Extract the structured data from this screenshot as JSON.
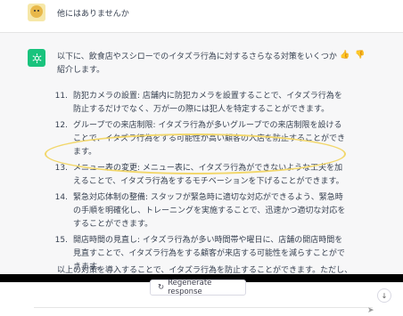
{
  "user_message": {
    "text": "他にはありませんか"
  },
  "assistant": {
    "intro": "以下に、飲食店やスシローでのイタズラ行為に対するさらなる対策をいくつか紹介します。",
    "items": [
      {
        "num": "11.",
        "text": "防犯カメラの設置: 店舗内に防犯カメラを設置することで、イタズラ行為を防止するだけでなく、万が一の際には犯人を特定することができます。"
      },
      {
        "num": "12.",
        "text": "グループでの来店制限: イタズラ行為が多いグループでの来店制限を設けることで、イタズラ行為をする可能性が高い顧客の入店を防止することができます。"
      },
      {
        "num": "13.",
        "text": "メニュー表の変更: メニュー表に、イタズラ行為ができないような工夫を加えることで、イタズラ行為をするモチベーションを下げることができます。"
      },
      {
        "num": "14.",
        "text": "緊急対応体制の整備: スタッフが緊急時に適切な対応ができるよう、緊急時の手順を明確化し、トレーニングを実施することで、迅速かつ適切な対応をすることができます。"
      },
      {
        "num": "15.",
        "text": "開店時間の見直し: イタズラ行為が多い時間帯や曜日に、店舗の開店時間を見直すことで、イタズラ行為をする顧客が来店する可能性を減らすことができます。"
      }
    ],
    "outro": "以上の対策を導入することで、イタズラ行為を防止することができます。ただし、"
  },
  "controls": {
    "regenerate_label": "Regenerate response",
    "regenerate_icon": "↻",
    "scroll_icon": "↓",
    "thumb_up_icon": "👍",
    "thumb_down_icon": "👎",
    "send_icon": "➤"
  },
  "colors": {
    "gpt_green": "#19c37d",
    "highlight_yellow": "#f2d76b"
  }
}
